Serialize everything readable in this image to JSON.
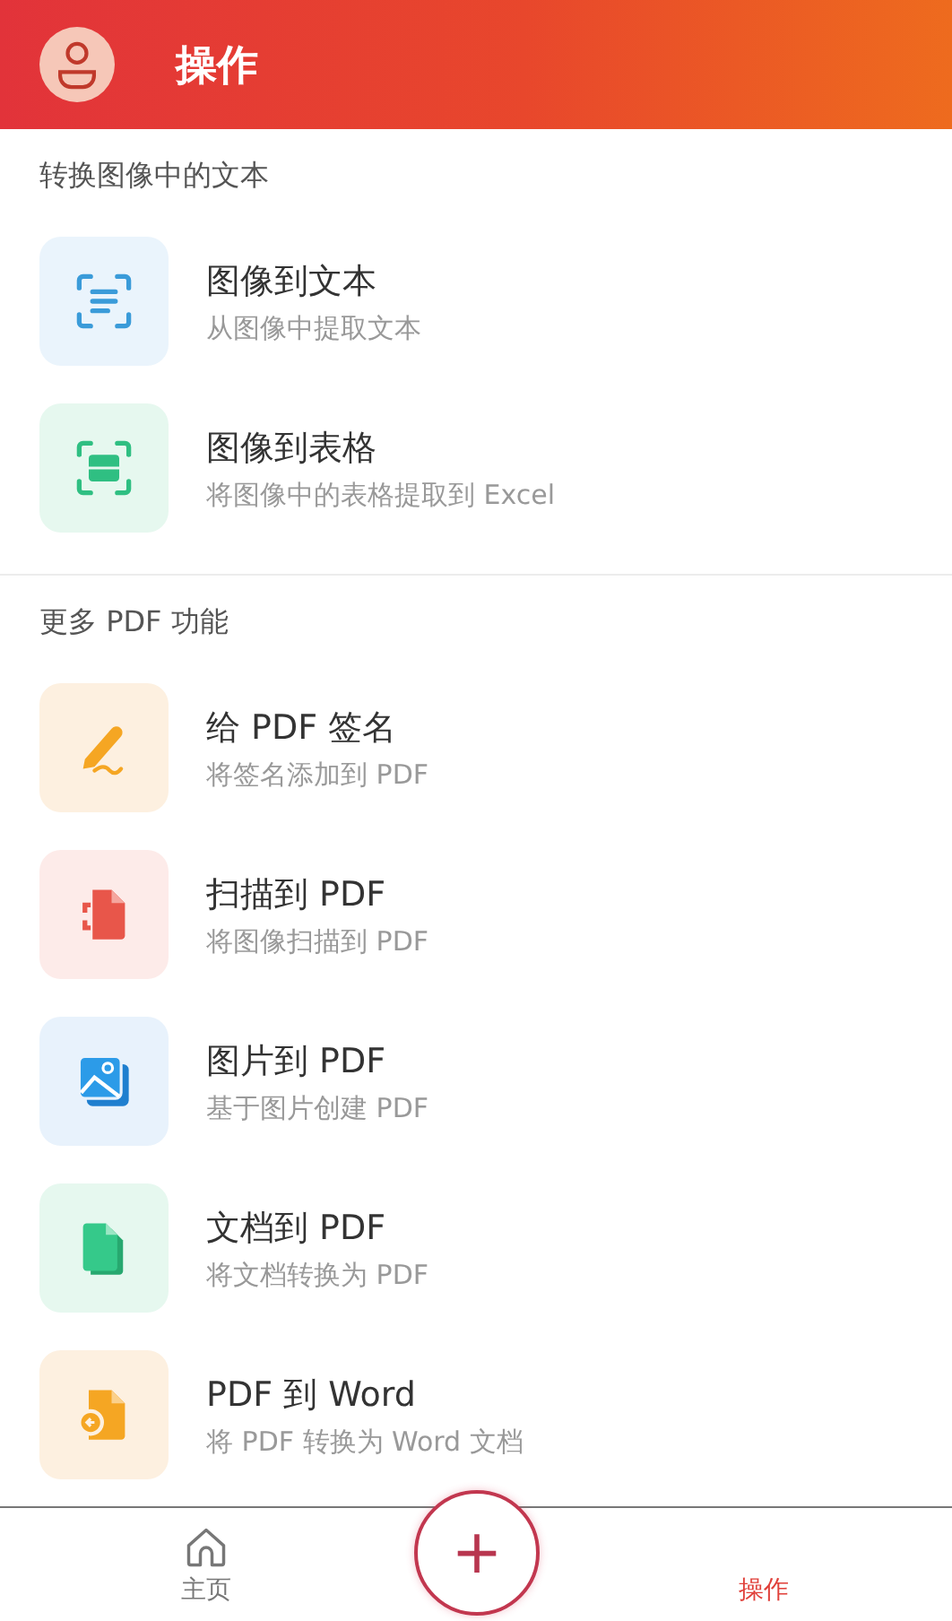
{
  "header": {
    "title": "操作"
  },
  "sections": [
    {
      "title": "转换图像中的文本",
      "items": [
        {
          "kind": "scan-text",
          "title": "图像到文本",
          "subtitle": "从图像中提取文本"
        },
        {
          "kind": "scan-table",
          "title": "图像到表格",
          "subtitle": "将图像中的表格提取到 Excel"
        }
      ]
    },
    {
      "title": "更多 PDF 功能",
      "items": [
        {
          "kind": "sign",
          "title": "给 PDF 签名",
          "subtitle": "将签名添加到 PDF"
        },
        {
          "kind": "scan-doc",
          "title": "扫描到 PDF",
          "subtitle": "将图像扫描到 PDF"
        },
        {
          "kind": "image",
          "title": "图片到 PDF",
          "subtitle": "基于图片创建 PDF"
        },
        {
          "kind": "document",
          "title": "文档到 PDF",
          "subtitle": "将文档转换为 PDF"
        },
        {
          "kind": "word",
          "title": "PDF 到 Word",
          "subtitle": "将 PDF 转换为 Word 文档"
        }
      ]
    }
  ],
  "bottom_nav": {
    "tabs": [
      {
        "kind": "home",
        "label": "主页",
        "selected": false
      },
      {
        "kind": "actions",
        "label": "操作",
        "selected": true
      }
    ],
    "fab": {
      "symbol": "+"
    }
  }
}
